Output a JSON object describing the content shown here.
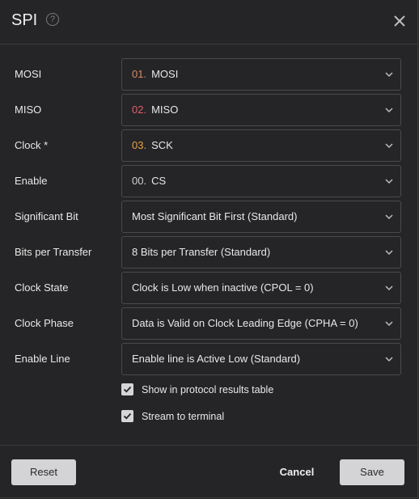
{
  "dialog": {
    "title": "SPI",
    "help_icon_glyph": "?"
  },
  "colors": {
    "mosi_number": "#d98a6a",
    "miso_number": "#e0606a",
    "clock_number": "#e8a04a",
    "enable_number": "#cfcfcf"
  },
  "fields": [
    {
      "label": "MOSI",
      "number": "01.",
      "value": "MOSI"
    },
    {
      "label": "MISO",
      "number": "02.",
      "value": "MISO"
    },
    {
      "label": "Clock *",
      "number": "03.",
      "value": "SCK"
    },
    {
      "label": "Enable",
      "number": "00.",
      "value": "CS"
    },
    {
      "label": "Significant Bit",
      "value": "Most Significant Bit First (Standard)"
    },
    {
      "label": "Bits per Transfer",
      "value": "8 Bits per Transfer (Standard)"
    },
    {
      "label": "Clock State",
      "value": "Clock is Low when inactive (CPOL = 0)"
    },
    {
      "label": "Clock Phase",
      "value": "Data is Valid on Clock Leading Edge (CPHA = 0)"
    },
    {
      "label": "Enable Line",
      "value": "Enable line is Active Low (Standard)"
    }
  ],
  "options": {
    "show_in_table": {
      "label": "Show in protocol results table",
      "checked": true
    },
    "stream_to_terminal": {
      "label": "Stream to terminal",
      "checked": true
    }
  },
  "footer": {
    "reset_label": "Reset",
    "cancel_label": "Cancel",
    "save_label": "Save"
  }
}
